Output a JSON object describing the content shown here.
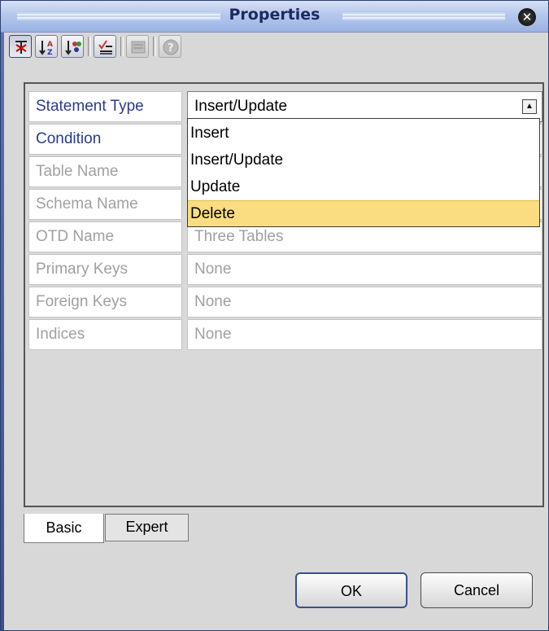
{
  "window": {
    "title": "Properties",
    "close_icon": "close-icon"
  },
  "toolbar": {
    "buttons": [
      {
        "icon": "categorized-view-icon",
        "state": "pressed"
      },
      {
        "icon": "sort-alphabetical-icon",
        "state": "normal"
      },
      {
        "icon": "sort-by-type-icon",
        "state": "normal"
      },
      {
        "icon": "show-editable-icon",
        "state": "normal"
      },
      {
        "icon": "property-editor-icon",
        "state": "disabled"
      },
      {
        "icon": "help-icon",
        "state": "disabled"
      }
    ]
  },
  "properties": [
    {
      "name": "Statement Type",
      "value": "Insert/Update",
      "enabled": true
    },
    {
      "name": "Condition",
      "value": "",
      "enabled": true
    },
    {
      "name": "Table Name",
      "value": "",
      "enabled": false
    },
    {
      "name": "Schema Name",
      "value": "",
      "enabled": false
    },
    {
      "name": "OTD Name",
      "value": "Three Tables",
      "enabled": false
    },
    {
      "name": "Primary Keys",
      "value": "None",
      "enabled": false
    },
    {
      "name": "Foreign Keys",
      "value": "None",
      "enabled": false
    },
    {
      "name": "Indices",
      "value": "None",
      "enabled": false
    }
  ],
  "dropdown": {
    "options": [
      "Insert",
      "Insert/Update",
      "Update",
      "Delete"
    ],
    "highlighted": "Delete"
  },
  "tabs": {
    "basic": "Basic",
    "expert": "Expert",
    "active": "Basic"
  },
  "buttons": {
    "ok": "OK",
    "cancel": "Cancel"
  },
  "colors": {
    "highlight": "#f9dd80",
    "active_label": "#2a3b8f",
    "disabled_text": "#a0a0a0"
  }
}
